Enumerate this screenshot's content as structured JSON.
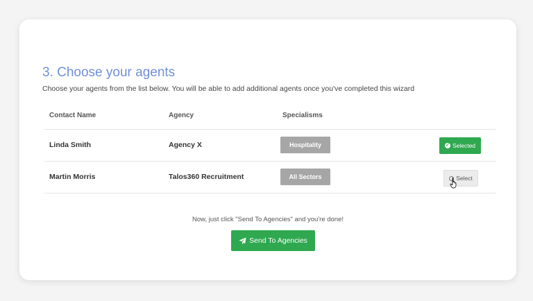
{
  "step": {
    "title": "3. Choose your agents",
    "description": "Choose your agents from the list below. You will be able to add additional agents once you've completed this wizard"
  },
  "table": {
    "headers": [
      "Contact Name",
      "Agency",
      "Specialisms"
    ],
    "rows": [
      {
        "contact": "Linda Smith",
        "agency": "Agency X",
        "specialism": "Hospitality",
        "action": "Selected",
        "selected": true
      },
      {
        "contact": "Martin Morris",
        "agency": "Talos360 Recruitment",
        "specialism": "All Sectors",
        "action": "Select",
        "selected": false
      }
    ]
  },
  "footer": {
    "hint": "Now, just click \"Send To Agencies\" and you're done!",
    "send_label": "Send To Agencies"
  },
  "colors": {
    "accent_blue": "#6f8fd8",
    "success_green": "#2fa84f",
    "tag_grey": "#a6a6a6"
  },
  "icons": {
    "selected": "check-circle-icon",
    "select": "radio-circle-icon",
    "send": "paper-plane-icon",
    "cursor": "hand-pointer-icon"
  }
}
